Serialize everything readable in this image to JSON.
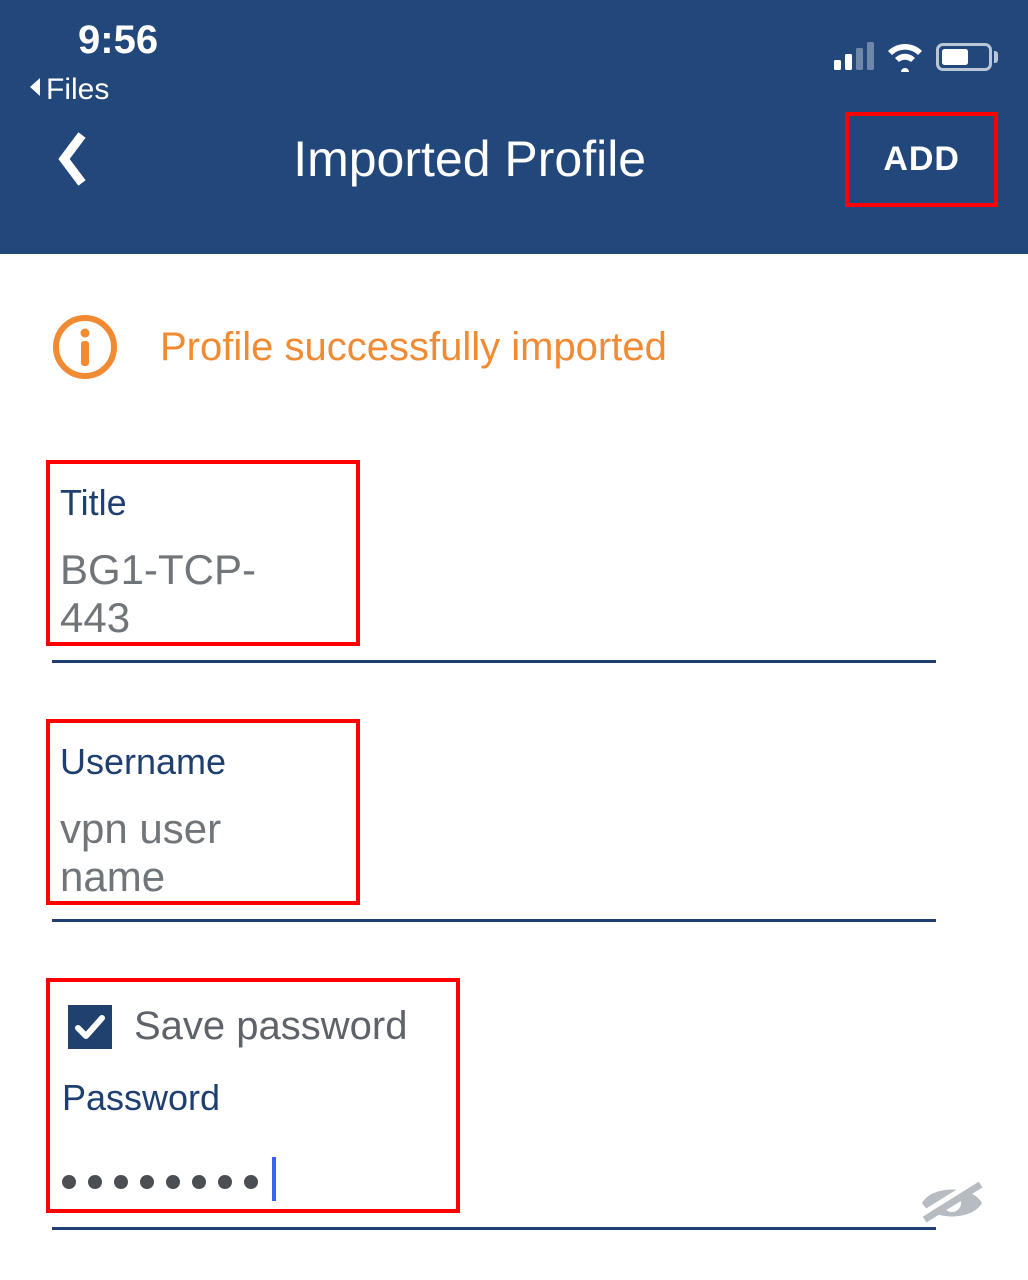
{
  "status_bar": {
    "time": "9:56",
    "back_app_label": "Files"
  },
  "header": {
    "title": "Imported Profile",
    "add_label": "ADD"
  },
  "notice": {
    "text": "Profile successfully imported"
  },
  "fields": {
    "title": {
      "label": "Title",
      "value": "BG1-TCP-443"
    },
    "username": {
      "label": "Username",
      "value": "vpn user name"
    },
    "save_password": {
      "label": "Save password",
      "checked": true
    },
    "password": {
      "label": "Password",
      "value": "●●●●●●●●",
      "dot_count": 8
    }
  },
  "colors": {
    "header_bg": "#22477a",
    "accent_orange": "#f08b34",
    "label_navy": "#1e3f70",
    "highlight_red": "#ff0000"
  }
}
